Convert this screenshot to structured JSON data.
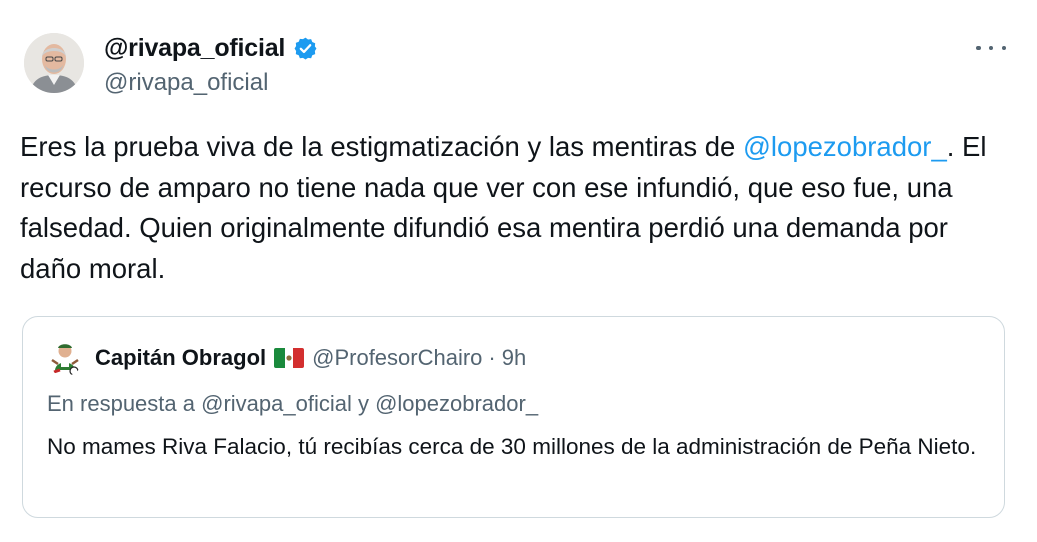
{
  "author": {
    "display_name": "@rivapa_oficial",
    "handle": "@rivapa_oficial",
    "verified_icon": "verified-badge-icon",
    "verified_color": "#1d9bf0"
  },
  "tweet": {
    "text_part1": "Eres la prueba viva de la estigmatización y las mentiras de ",
    "mention": "@lopezobrador_",
    "text_part2": ". El recurso de amparo no tiene nada que ver con ese infundió, que eso fue, una falsedad. Quien originalmente difundió esa mentira perdió una demanda por daño moral."
  },
  "quoted_tweet": {
    "display_name": "Capitán Obragol",
    "flag_icon": "mexico-flag-icon",
    "handle": "@ProfesorChairo",
    "separator": "·",
    "time": "9h",
    "reply_prefix": "En respuesta a ",
    "reply_mention_1": "@rivapa_oficial",
    "reply_joiner": " y ",
    "reply_mention_2": "@lopezobrador_",
    "text": "No mames Riva Falacio, tú recibías cerca de 30 millones de la administración de Peña Nieto."
  },
  "colors": {
    "link": "#1d9bf0",
    "secondary_text": "#536471",
    "primary_text": "#0f1419",
    "border": "#cfd9de"
  }
}
